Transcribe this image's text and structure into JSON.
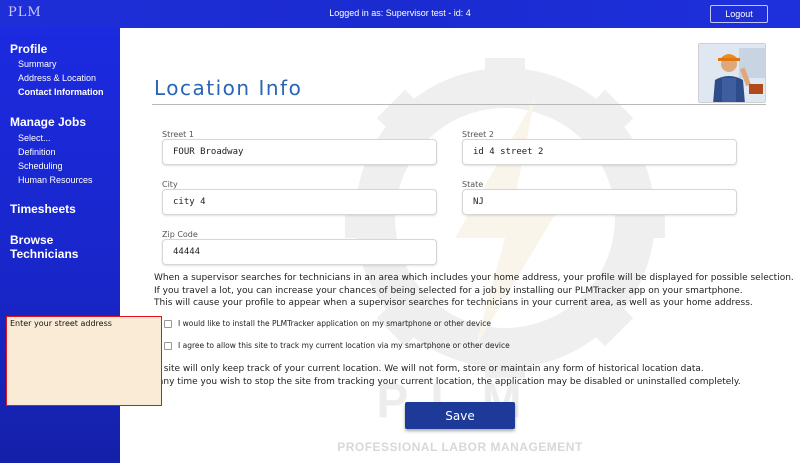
{
  "header": {
    "logo": "PLM",
    "logged_in_text": "Logged in as: Supervisor test - id: 4",
    "logout_label": "Logout"
  },
  "sidebar": {
    "sections": [
      {
        "label": "Profile",
        "items": [
          "Summary",
          "Address & Location",
          "Contact Information"
        ]
      },
      {
        "label": "Manage Jobs",
        "items": [
          "Select...",
          "Definition",
          "Scheduling",
          "Human Resources"
        ]
      },
      {
        "label": "Timesheets",
        "items": []
      },
      {
        "label": "Browse Technicians",
        "items": []
      }
    ],
    "active_item": "Contact Information"
  },
  "page": {
    "title": "Location Info",
    "watermark_plm": "PLM",
    "watermark_text": "PROFESSIONAL LABOR MANAGEMENT"
  },
  "form": {
    "street1": {
      "label": "Street 1",
      "value": "FOUR Broadway"
    },
    "street2": {
      "label": "Street 2",
      "value": "id 4 street 2"
    },
    "city": {
      "label": "City",
      "value": "city 4"
    },
    "state": {
      "label": "State",
      "value": "NJ"
    },
    "zip": {
      "label": "Zip Code",
      "value": "44444"
    }
  },
  "info_lines": [
    "When a supervisor searches for technicians in an area which includes your home address, your profile will be displayed for possible selection.",
    "If you travel a lot, you can increase your chances of being selected for a job by installing our PLMTracker app on your smartphone.",
    "This will cause your profile to appear when a supervisor searches for technicians in your current area, as well as your home address."
  ],
  "checkboxes": [
    {
      "label": "I would like to install the PLMTracker application on my smartphone or other device",
      "checked": false
    },
    {
      "label": "I agree to allow this site to track my current location via my smartphone or other device",
      "checked": false
    }
  ],
  "info2_lines": [
    "our site will only keep track of your current location. We will not form, store or maintain any form of historical location data.",
    "at any time you wish to stop the site from tracking your current location, the application may be disabled or uninstalled completely."
  ],
  "save_label": "Save",
  "tooltip_text": "Enter your street address",
  "colors": {
    "sidebar_blue": "#1c2ae0",
    "title_blue": "#2a64b6",
    "save_button": "#1e3a98",
    "tooltip_bg": "#faebd7",
    "tooltip_border": "#e0141e"
  }
}
